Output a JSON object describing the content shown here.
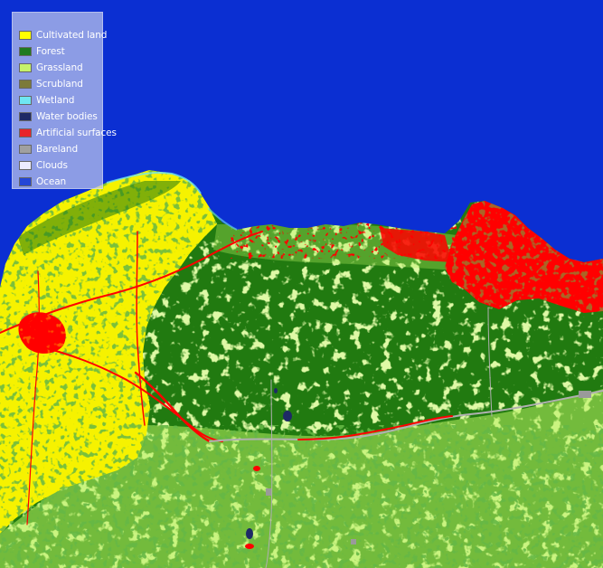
{
  "map": {
    "type": "land-cover-classification",
    "background_class": "Ocean"
  },
  "legend": {
    "items": [
      {
        "label": "Cultivated land",
        "color": "#ffff00"
      },
      {
        "label": "Forest",
        "color": "#1f7a1f"
      },
      {
        "label": "Grassland",
        "color": "#c6f26b"
      },
      {
        "label": "Scrubland",
        "color": "#7c7a3a"
      },
      {
        "label": "Wetland",
        "color": "#6fe6f2"
      },
      {
        "label": "Water bodies",
        "color": "#1e2a66"
      },
      {
        "label": "Artificial surfaces",
        "color": "#e8242a"
      },
      {
        "label": "Bareland",
        "color": "#a0a0a0"
      },
      {
        "label": "Clouds",
        "color": "#ececff"
      },
      {
        "label": "Ocean",
        "color": "#2446d6"
      }
    ]
  },
  "colors": {
    "ocean": "#0b2fd2",
    "forest": "#217a10",
    "cultivated": "#f6f200",
    "grassland": "#b8f060",
    "artificial": "#ff0000",
    "scrubland": "#7c7a3a",
    "water": "#1e2a66",
    "bareland": "#9a9a9a",
    "wetland": "#6fe6f2"
  }
}
